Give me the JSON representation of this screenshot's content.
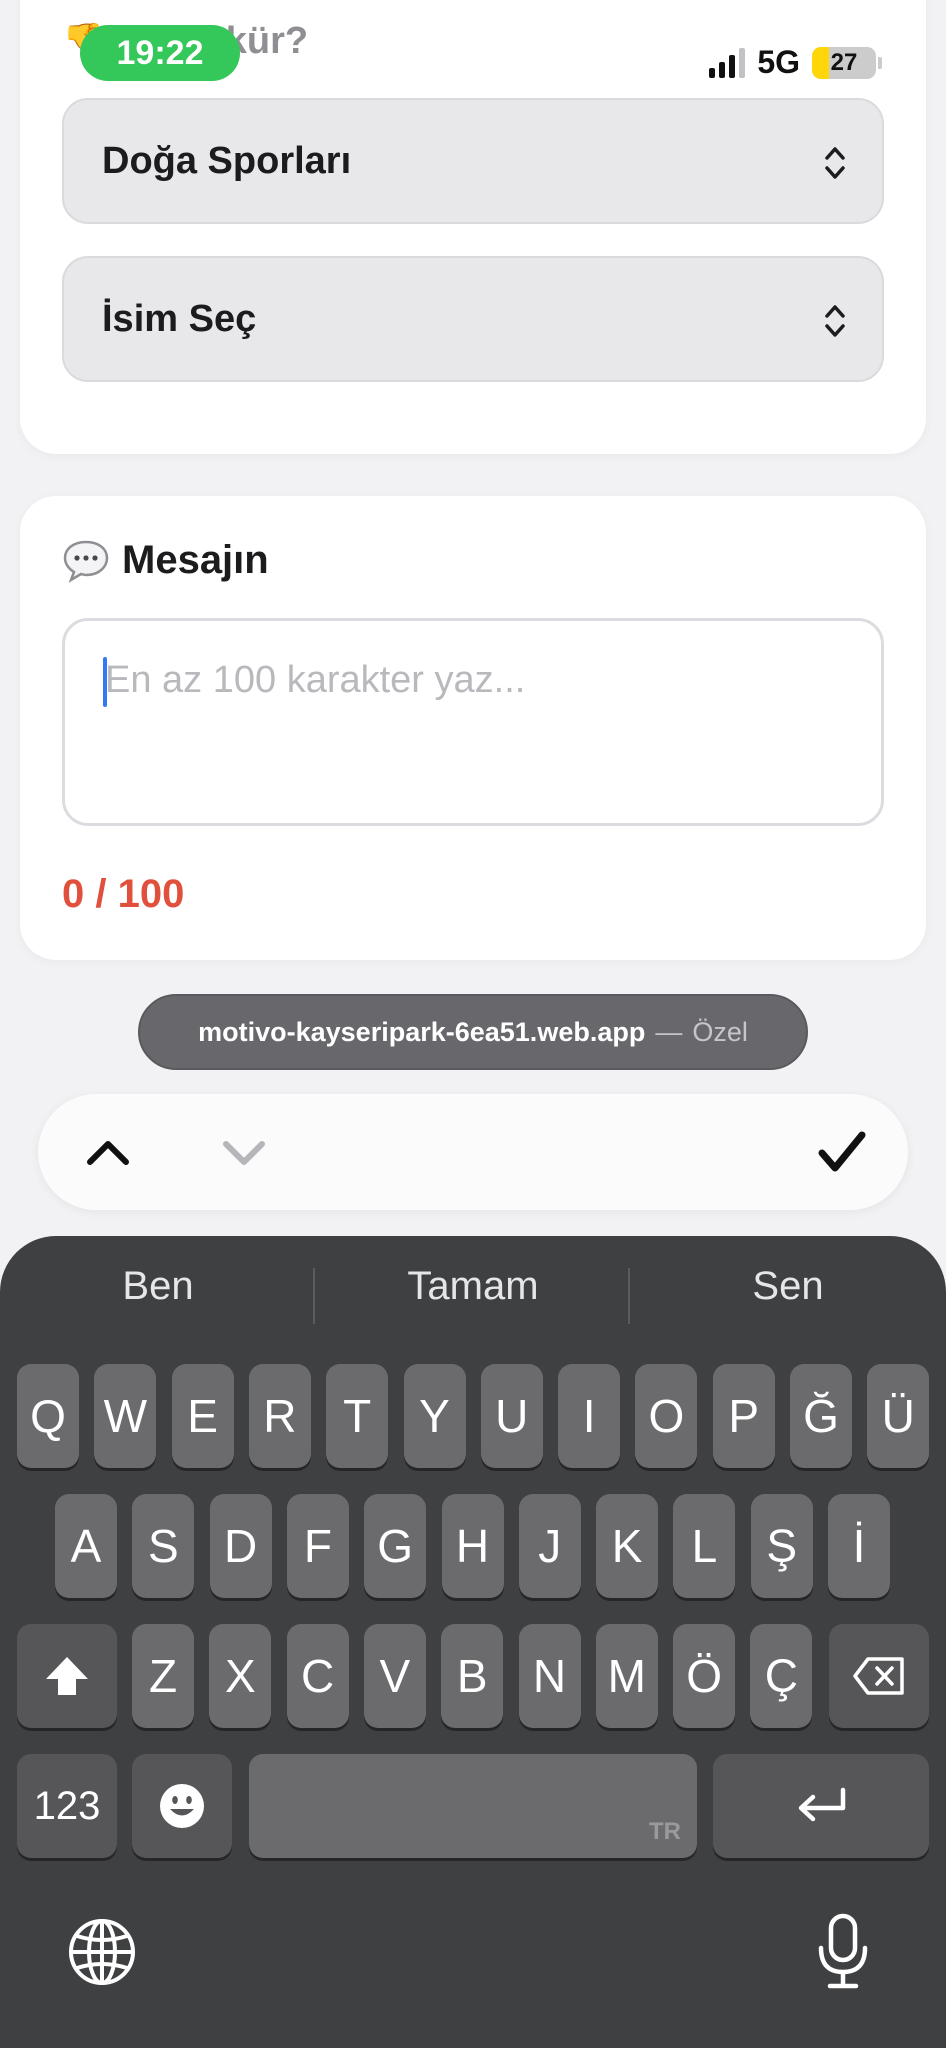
{
  "status_bar": {
    "time": "19:22",
    "network": "5G",
    "battery_level": "27",
    "battery_fraction": 0.27,
    "colors": {
      "time_pill": "#34c759",
      "battery": "#ffd60a"
    }
  },
  "top_card": {
    "question_emoji": "👎",
    "question_title": "Teşekkür?",
    "select_category": "Doğa Sporları",
    "select_name": "İsim Seç",
    "select_icon": "chevron-up-down-icon"
  },
  "message_card": {
    "icon": "speech-bubble-icon",
    "title": "Mesajın",
    "placeholder": "En az 100 karakter yaz...",
    "value": "",
    "counter": "0 / 100",
    "counter_color": "#e0503c"
  },
  "url_pill": {
    "domain": "motivo-kayseripark-6ea51.web.app",
    "separator": "—",
    "mode": "Özel"
  },
  "form_toolbar": {
    "prev_icon": "chevron-up-icon",
    "next_icon": "chevron-down-icon",
    "done_icon": "checkmark-icon"
  },
  "keyboard": {
    "suggestions": [
      "Ben",
      "Tamam",
      "Sen"
    ],
    "row1": [
      "Q",
      "W",
      "E",
      "R",
      "T",
      "Y",
      "U",
      "I",
      "O",
      "P",
      "Ğ",
      "Ü"
    ],
    "row2": [
      "A",
      "S",
      "D",
      "F",
      "G",
      "H",
      "J",
      "K",
      "L",
      "Ş",
      "İ"
    ],
    "row3": [
      "Z",
      "X",
      "C",
      "V",
      "B",
      "N",
      "M",
      "Ö",
      "Ç"
    ],
    "numbers_label": "123",
    "space_lang": "TR",
    "icons": {
      "shift": "shift-icon",
      "delete": "backspace-icon",
      "emoji": "emoji-icon",
      "return": "return-icon",
      "globe": "globe-icon",
      "mic": "microphone-icon"
    }
  }
}
